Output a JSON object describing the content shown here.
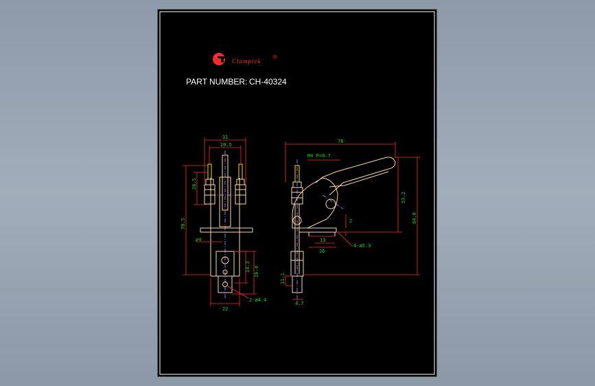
{
  "colors": {
    "sheet_bg": "#000000",
    "frame": "#ffffff",
    "part_outline": "#ffd9a0",
    "dimension": "#00e000",
    "leader": "#ff2a2a",
    "center": "#9a6cff",
    "logo": "#ff2a2a"
  },
  "logo": {
    "mark": "G",
    "text": "Clamptek",
    "reg": "®"
  },
  "part_number": {
    "label": "PART NUMBER:",
    "value": "CH-40324"
  },
  "front_view": {
    "dims": {
      "width_31": "31",
      "width_20_5": "20.5",
      "h_26_5": "26.5",
      "h_78_5": "78.5",
      "dia_4": "ø4",
      "h_14_3": "14.3",
      "h_26_4": "26.4",
      "width_22": "22",
      "holes": "2-ø4.4"
    }
  },
  "side_view": {
    "dims": {
      "length_78": "78",
      "thread": "M4 P=0.7",
      "h_53_2": "53.2",
      "h_84_9": "84.9",
      "h_2": "2",
      "w_13": "13",
      "w_26": "26",
      "holes": "4-ø5.3",
      "h_11_1": "11.1",
      "w_4_7": "4.7"
    }
  }
}
